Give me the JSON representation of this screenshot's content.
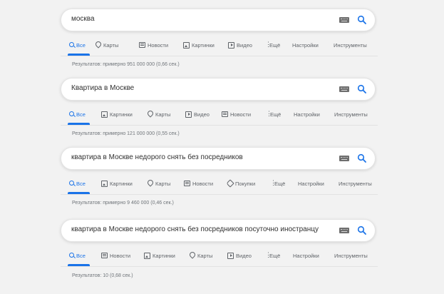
{
  "blocks": [
    {
      "query": "москва",
      "tabs": [
        {
          "label": "Все",
          "icon": "search-icon",
          "active": true
        },
        {
          "label": "Карты",
          "icon": "map-pin-icon"
        },
        {
          "label": "Новости",
          "icon": "news-icon"
        },
        {
          "label": "Картинки",
          "icon": "image-icon"
        },
        {
          "label": "Видео",
          "icon": "video-icon"
        },
        {
          "label": "Ещё",
          "icon": "more-vert-icon"
        },
        {
          "label": "Настройки"
        },
        {
          "label": "Инструменты"
        }
      ],
      "stats": "Результатов: примерно 951 000 000 (0,66 сек.)"
    },
    {
      "query": "Квартира в Москве",
      "tabs": [
        {
          "label": "Все",
          "icon": "search-icon",
          "active": true
        },
        {
          "label": "Картинки",
          "icon": "image-icon"
        },
        {
          "label": "Карты",
          "icon": "map-pin-icon"
        },
        {
          "label": "Видео",
          "icon": "video-icon"
        },
        {
          "label": "Новости",
          "icon": "news-icon"
        },
        {
          "label": "Ещё",
          "icon": "more-vert-icon"
        },
        {
          "label": "Настройки"
        },
        {
          "label": "Инструменты"
        }
      ],
      "stats": "Результатов: примерно 121 000 000 (0,55 сек.)"
    },
    {
      "query": "квартира в Москве недорого снять без посредников",
      "tabs": [
        {
          "label": "Все",
          "icon": "search-icon",
          "active": true
        },
        {
          "label": "Картинки",
          "icon": "image-icon"
        },
        {
          "label": "Карты",
          "icon": "map-pin-icon"
        },
        {
          "label": "Новости",
          "icon": "news-icon"
        },
        {
          "label": "Покупки",
          "icon": "tag-icon"
        },
        {
          "label": "Ещё",
          "icon": "more-vert-icon"
        },
        {
          "label": "Настройки"
        },
        {
          "label": "Инструменты"
        }
      ],
      "stats": "Результатов: примерно 9 460 000 (0,46 сек.)"
    },
    {
      "query": "квартира в Москве недорого снять без посредников посуточно иностранцу",
      "tabs": [
        {
          "label": "Все",
          "icon": "search-icon",
          "active": true
        },
        {
          "label": "Новости",
          "icon": "news-icon"
        },
        {
          "label": "Картинки",
          "icon": "image-icon"
        },
        {
          "label": "Карты",
          "icon": "map-pin-icon"
        },
        {
          "label": "Видео",
          "icon": "video-icon"
        },
        {
          "label": "Ещё",
          "icon": "more-vert-icon"
        },
        {
          "label": "Настройки"
        },
        {
          "label": "Инструменты"
        }
      ],
      "stats": "Результатов: 10 (0,68 сек.)"
    }
  ],
  "colors": {
    "accent": "#1a73e8",
    "tab_text": "#5f6368",
    "stats_text": "#70757a",
    "background": "#f2f2f2"
  }
}
